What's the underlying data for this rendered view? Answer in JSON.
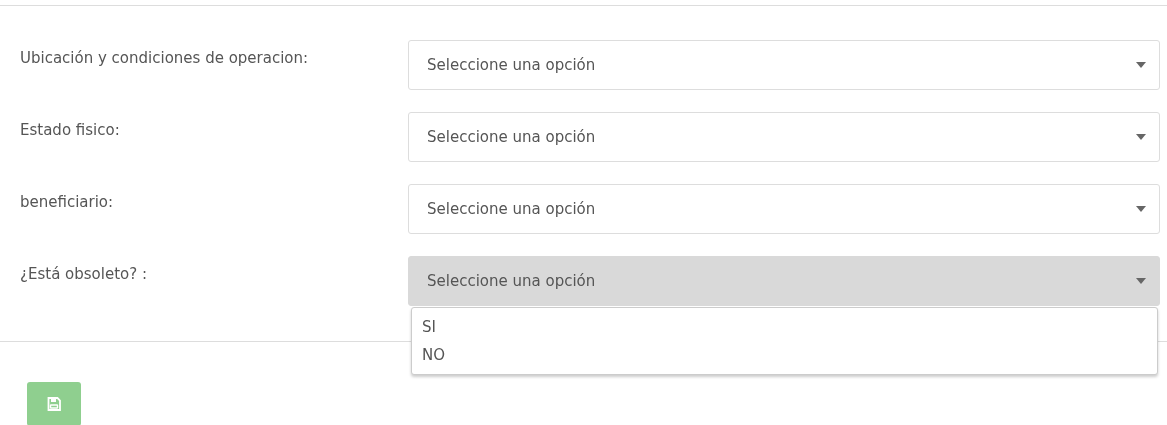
{
  "fields": [
    {
      "label": "Ubicación y condiciones de operacion:",
      "placeholder": "Seleccione una opción",
      "open": false
    },
    {
      "label": "Estado fisico:",
      "placeholder": "Seleccione una opción",
      "open": false
    },
    {
      "label": "beneficiario:",
      "placeholder": "Seleccione una opción",
      "open": false
    },
    {
      "label": "¿Está obsoleto? :",
      "placeholder": "Seleccione una opción",
      "open": true,
      "options": [
        {
          "label": "SI",
          "selected": false
        },
        {
          "label": "NO",
          "selected": false
        }
      ]
    }
  ],
  "save_button": {
    "disabled": true
  }
}
